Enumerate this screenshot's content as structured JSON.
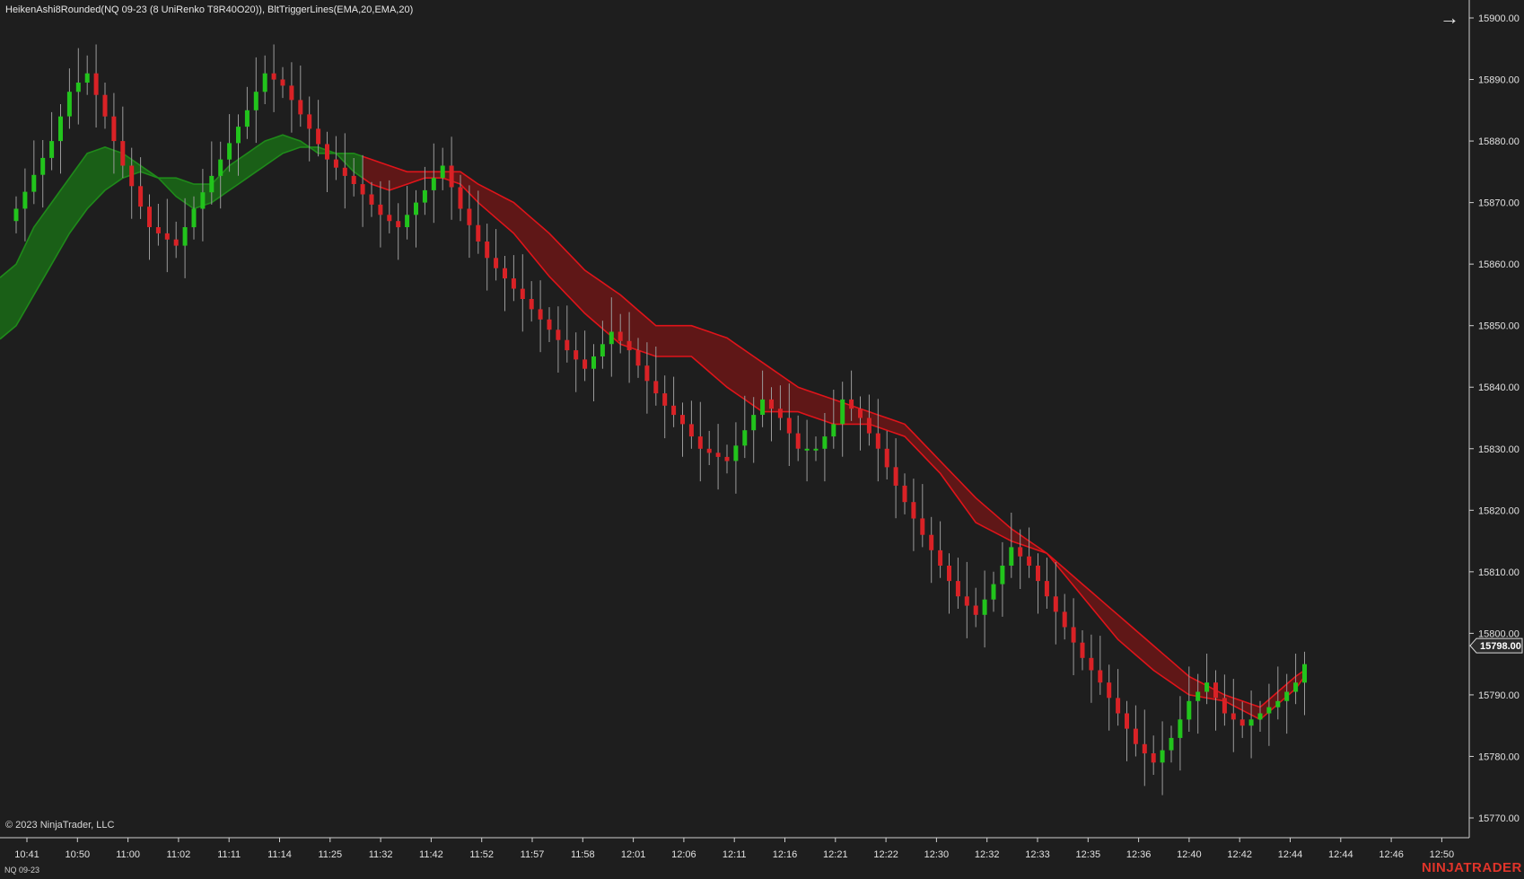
{
  "header": {
    "title": "HeikenAshi8Rounded(NQ 09-23 (8 UniRenko T8R40O20)), BltTriggerLines(EMA,20,EMA,20)"
  },
  "footer": {
    "copyright": "© 2023 NinjaTrader, LLC",
    "instrument": "NQ 09-23",
    "brand": "NINJATRADER"
  },
  "icons": {
    "arrow": "arrow-right-icon"
  },
  "colors": {
    "background": "#1e1e1e",
    "up_candle": "#22c41c",
    "down_candle": "#d92226",
    "band_bull": "#1a6b16",
    "band_bear": "#6b1616",
    "band_line_bull": "#1f8a1a",
    "band_line_bear": "#e0141a",
    "wick": "#9a9a9a",
    "price_label_bg": "#2b2b2b"
  },
  "chart_data": {
    "type": "candlestick",
    "title": "HeikenAshi8Rounded(NQ 09-23 (8 UniRenko T8R40O20)), BltTriggerLines(EMA,20,EMA,20)",
    "x_tick_labels": [
      "10:41",
      "10:50",
      "11:00",
      "11:02",
      "11:11",
      "11:14",
      "11:25",
      "11:32",
      "11:42",
      "11:52",
      "11:57",
      "11:58",
      "12:01",
      "12:06",
      "12:11",
      "12:16",
      "12:21",
      "12:22",
      "12:30",
      "12:32",
      "12:33",
      "12:35",
      "12:36",
      "12:40",
      "12:42",
      "12:44",
      "12:44",
      "12:46",
      "12:50"
    ],
    "y_tick_labels": [
      "15900.00",
      "15890.00",
      "15880.00",
      "15870.00",
      "15860.00",
      "15850.00",
      "15840.00",
      "15830.00",
      "15820.00",
      "15810.00",
      "15800.00",
      "15790.00",
      "15780.00",
      "15770.00"
    ],
    "ylim": [
      15767,
      15903
    ],
    "last_price": "15798.00",
    "series": [
      {
        "name": "BltTriggerLines EMA 20",
        "type": "band"
      },
      {
        "name": "HeikenAshi8Rounded",
        "type": "candles"
      }
    ],
    "close_path": [
      [
        0,
        15869
      ],
      [
        4,
        15880
      ],
      [
        6,
        15888
      ],
      [
        8,
        15891
      ],
      [
        10,
        15884
      ],
      [
        12,
        15876
      ],
      [
        15,
        15866
      ],
      [
        18,
        15863
      ],
      [
        20,
        15869
      ],
      [
        23,
        15877
      ],
      [
        26,
        15885
      ],
      [
        28,
        15891
      ],
      [
        30,
        15889
      ],
      [
        33,
        15882
      ],
      [
        35,
        15877
      ],
      [
        38,
        15873
      ],
      [
        41,
        15868
      ],
      [
        43,
        15866
      ],
      [
        45,
        15870
      ],
      [
        47,
        15874
      ],
      [
        48,
        15876
      ],
      [
        50,
        15869
      ],
      [
        53,
        15861
      ],
      [
        56,
        15856
      ],
      [
        59,
        15851
      ],
      [
        62,
        15846
      ],
      [
        64,
        15843
      ],
      [
        66,
        15847
      ],
      [
        67,
        15849
      ],
      [
        69,
        15846
      ],
      [
        71,
        15841
      ],
      [
        73,
        15837
      ],
      [
        75,
        15834
      ],
      [
        77,
        15830
      ],
      [
        80,
        15828
      ],
      [
        82,
        15833
      ],
      [
        84,
        15838
      ],
      [
        86,
        15835
      ],
      [
        88,
        15830
      ],
      [
        90,
        15830
      ],
      [
        92,
        15834
      ],
      [
        93,
        15838
      ],
      [
        95,
        15835
      ],
      [
        97,
        15830
      ],
      [
        99,
        15824
      ],
      [
        102,
        15816
      ],
      [
        104,
        15811
      ],
      [
        106,
        15806
      ],
      [
        108,
        15803
      ],
      [
        110,
        15808
      ],
      [
        112,
        15814
      ],
      [
        114,
        15811
      ],
      [
        116,
        15806
      ],
      [
        118,
        15801
      ],
      [
        120,
        15796
      ],
      [
        122,
        15792
      ],
      [
        124,
        15787
      ],
      [
        126,
        15782
      ],
      [
        128,
        15779
      ],
      [
        130,
        15783
      ],
      [
        132,
        15789
      ],
      [
        134,
        15792
      ],
      [
        136,
        15787
      ],
      [
        138,
        15785
      ],
      [
        140,
        15787
      ],
      [
        142,
        15789
      ],
      [
        144,
        15792
      ],
      [
        145,
        15795
      ]
    ],
    "band_upper_path": [
      [
        0,
        15860
      ],
      [
        2,
        15866
      ],
      [
        4,
        15870
      ],
      [
        6,
        15874
      ],
      [
        8,
        15878
      ],
      [
        10,
        15879
      ],
      [
        12,
        15878
      ],
      [
        14,
        15876
      ],
      [
        16,
        15874
      ],
      [
        18,
        15874
      ],
      [
        20,
        15873
      ],
      [
        22,
        15873
      ],
      [
        24,
        15876
      ],
      [
        26,
        15878
      ],
      [
        28,
        15880
      ],
      [
        30,
        15881
      ],
      [
        32,
        15880
      ],
      [
        34,
        15878
      ],
      [
        36,
        15878
      ],
      [
        38,
        15878
      ],
      [
        40,
        15877
      ],
      [
        42,
        15876
      ],
      [
        44,
        15875
      ],
      [
        46,
        15875
      ],
      [
        48,
        15875
      ],
      [
        50,
        15875
      ],
      [
        52,
        15873
      ],
      [
        56,
        15870
      ],
      [
        60,
        15865
      ],
      [
        64,
        15859
      ],
      [
        68,
        15855
      ],
      [
        72,
        15850
      ],
      [
        76,
        15850
      ],
      [
        80,
        15848
      ],
      [
        84,
        15844
      ],
      [
        88,
        15840
      ],
      [
        92,
        15838
      ],
      [
        96,
        15836
      ],
      [
        100,
        15834
      ],
      [
        104,
        15828
      ],
      [
        108,
        15822
      ],
      [
        112,
        15817
      ],
      [
        116,
        15813
      ],
      [
        120,
        15808
      ],
      [
        124,
        15803
      ],
      [
        128,
        15798
      ],
      [
        132,
        15793
      ],
      [
        136,
        15790
      ],
      [
        140,
        15788
      ],
      [
        144,
        15793
      ],
      [
        145,
        15794
      ]
    ],
    "band_lower_path": [
      [
        0,
        15850
      ],
      [
        2,
        15855
      ],
      [
        4,
        15860
      ],
      [
        6,
        15865
      ],
      [
        8,
        15869
      ],
      [
        10,
        15872
      ],
      [
        12,
        15874
      ],
      [
        14,
        15875
      ],
      [
        16,
        15874
      ],
      [
        18,
        15871
      ],
      [
        20,
        15869
      ],
      [
        22,
        15870
      ],
      [
        24,
        15872
      ],
      [
        26,
        15874
      ],
      [
        28,
        15876
      ],
      [
        30,
        15878
      ],
      [
        32,
        15879
      ],
      [
        34,
        15879
      ],
      [
        36,
        15878
      ],
      [
        38,
        15875
      ],
      [
        40,
        15873
      ],
      [
        42,
        15872
      ],
      [
        44,
        15873
      ],
      [
        46,
        15874
      ],
      [
        48,
        15874
      ],
      [
        50,
        15873
      ],
      [
        52,
        15870
      ],
      [
        56,
        15865
      ],
      [
        60,
        15858
      ],
      [
        64,
        15852
      ],
      [
        68,
        15847
      ],
      [
        72,
        15845
      ],
      [
        76,
        15845
      ],
      [
        80,
        15840
      ],
      [
        84,
        15836
      ],
      [
        88,
        15836
      ],
      [
        92,
        15834
      ],
      [
        96,
        15834
      ],
      [
        100,
        15832
      ],
      [
        104,
        15826
      ],
      [
        108,
        15818
      ],
      [
        112,
        15815
      ],
      [
        116,
        15813
      ],
      [
        120,
        15806
      ],
      [
        124,
        15799
      ],
      [
        128,
        15794
      ],
      [
        132,
        15790
      ],
      [
        136,
        15789
      ],
      [
        140,
        15786
      ],
      [
        144,
        15791
      ],
      [
        145,
        15793
      ]
    ],
    "grid": false
  }
}
